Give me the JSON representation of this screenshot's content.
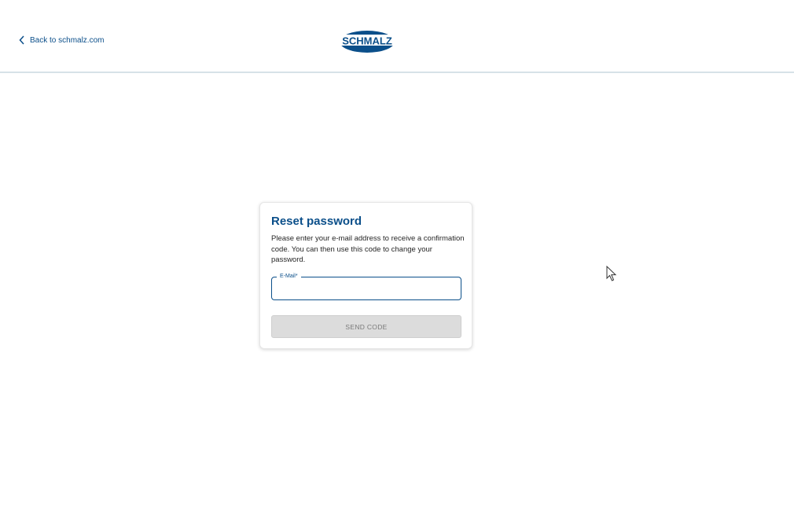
{
  "header": {
    "back_link_label": "Back to schmalz.com",
    "logo_text": "SCHMALZ",
    "brand_color": "#0b4f8a"
  },
  "reset": {
    "title": "Reset password",
    "description": "Please enter your e-mail address to receive a confirmation code. You can then use this code to change your password.",
    "email_label": "E-Mail*",
    "email_value": "",
    "send_button_label": "SEND CODE"
  },
  "icons": {
    "back": "chevron-left-icon",
    "cursor": "mouse-pointer-icon"
  }
}
